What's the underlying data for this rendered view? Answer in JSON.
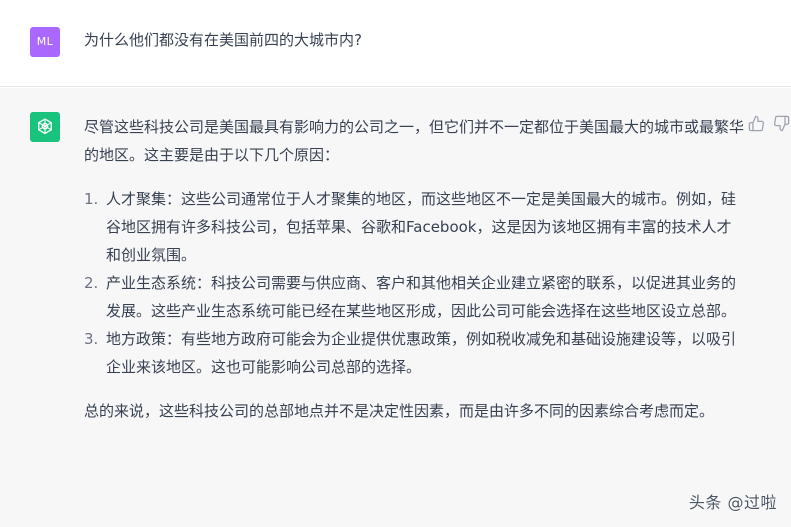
{
  "user_message": {
    "avatar_initials": "ML",
    "text": "为什么他们都没有在美国前四的大城市内?"
  },
  "assistant_message": {
    "intro": "尽管这些科技公司是美国最具有影响力的公司之一，但它们并不一定都位于美国最大的城市或最繁华的地区。这主要是由于以下几个原因：",
    "items": [
      {
        "num": "1.",
        "text": "人才聚集：这些公司通常位于人才聚集的地区，而这些地区不一定是美国最大的城市。例如，硅谷地区拥有许多科技公司，包括苹果、谷歌和Facebook，这是因为该地区拥有丰富的技术人才和创业氛围。"
      },
      {
        "num": "2.",
        "text": "产业生态系统：科技公司需要与供应商、客户和其他相关企业建立紧密的联系，以促进其业务的发展。这些产业生态系统可能已经在某些地区形成，因此公司可能会选择在这些地区设立总部。"
      },
      {
        "num": "3.",
        "text": "地方政策：有些地方政府可能会为企业提供优惠政策，例如税收减免和基础设施建设等，以吸引企业来该地区。这也可能影响公司总部的选择。"
      }
    ],
    "outro": "总的来说，这些科技公司的总部地点并不是决定性因素，而是由许多不同的因素综合考虑而定。"
  },
  "actions": {
    "thumbs_up_icon": "thumbs-up-icon",
    "thumbs_down_icon": "thumbs-down-icon"
  },
  "watermark": "头条 @过啦",
  "colors": {
    "user_avatar": "#ab68ff",
    "assistant_avatar": "#19c37d",
    "assistant_bg": "#f7f7f8",
    "text": "#374151"
  }
}
